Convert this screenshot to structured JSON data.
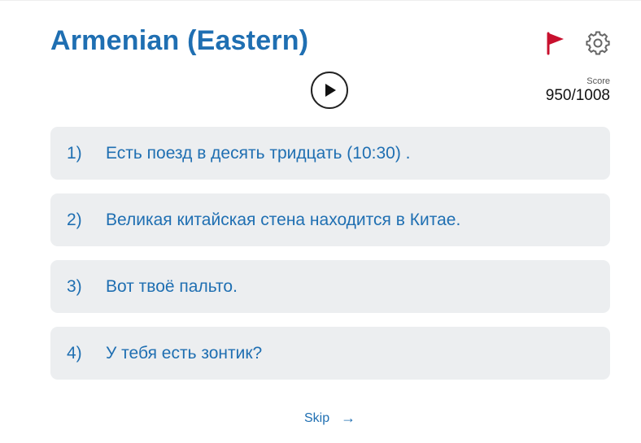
{
  "header": {
    "title": "Armenian (Eastern)"
  },
  "icons": {
    "flag": "flag-icon",
    "settings": "gear-icon",
    "play": "play-icon",
    "skip_arrow": "arrow-right-icon"
  },
  "colors": {
    "accent": "#1f6fb2",
    "flag": "#c8102e",
    "option_bg": "#eceef0"
  },
  "score": {
    "label": "Score",
    "value": "950/1008"
  },
  "options": [
    {
      "number": "1)",
      "text": "Есть поезд в десять тридцать (10:30) ."
    },
    {
      "number": "2)",
      "text": "Великая китайская стена находится в Китае."
    },
    {
      "number": "3)",
      "text": "Вот твоё пальто."
    },
    {
      "number": "4)",
      "text": "У тебя есть зонтик?"
    }
  ],
  "footer": {
    "skip_label": "Skip",
    "skip_arrow": "→"
  }
}
